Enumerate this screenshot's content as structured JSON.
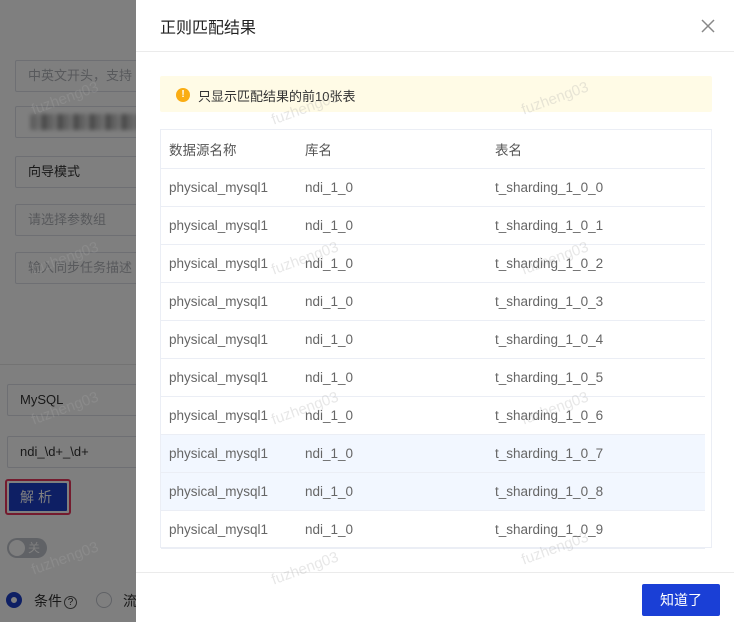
{
  "background": {
    "name_input_placeholder": "中英文开头，支持",
    "mode_value": "向导模式",
    "param_group_placeholder": "请选择参数组",
    "desc_placeholder": "输入同步任务描述",
    "db_type_value": "MySQL",
    "regex_value": "ndi_\\d+_\\d+",
    "parse_label": "解析",
    "switch_label": "关",
    "radio_condition_label": "条件",
    "radio_flow_label": "流"
  },
  "watermark_text": "fuzheng03",
  "drawer": {
    "title": "正则匹配结果",
    "notice": "只显示匹配结果的前10张表",
    "columns": [
      "数据源名称",
      "库名",
      "表名"
    ],
    "rows": [
      [
        "physical_mysql1",
        "ndi_1_0",
        "t_sharding_1_0_0"
      ],
      [
        "physical_mysql1",
        "ndi_1_0",
        "t_sharding_1_0_1"
      ],
      [
        "physical_mysql1",
        "ndi_1_0",
        "t_sharding_1_0_2"
      ],
      [
        "physical_mysql1",
        "ndi_1_0",
        "t_sharding_1_0_3"
      ],
      [
        "physical_mysql1",
        "ndi_1_0",
        "t_sharding_1_0_4"
      ],
      [
        "physical_mysql1",
        "ndi_1_0",
        "t_sharding_1_0_5"
      ],
      [
        "physical_mysql1",
        "ndi_1_0",
        "t_sharding_1_0_6"
      ],
      [
        "physical_mysql1",
        "ndi_1_0",
        "t_sharding_1_0_7"
      ],
      [
        "physical_mysql1",
        "ndi_1_0",
        "t_sharding_1_0_8"
      ],
      [
        "physical_mysql1",
        "ndi_1_0",
        "t_sharding_1_0_9"
      ]
    ],
    "highlighted_rows": [
      7,
      8
    ],
    "ok_label": "知道了"
  },
  "colors": {
    "primary": "#1a3fd6",
    "warning": "#faad14",
    "notice_bg": "#fffbe6",
    "highlight_row": "#f2f7ff",
    "parse_outline": "#e8365d"
  }
}
